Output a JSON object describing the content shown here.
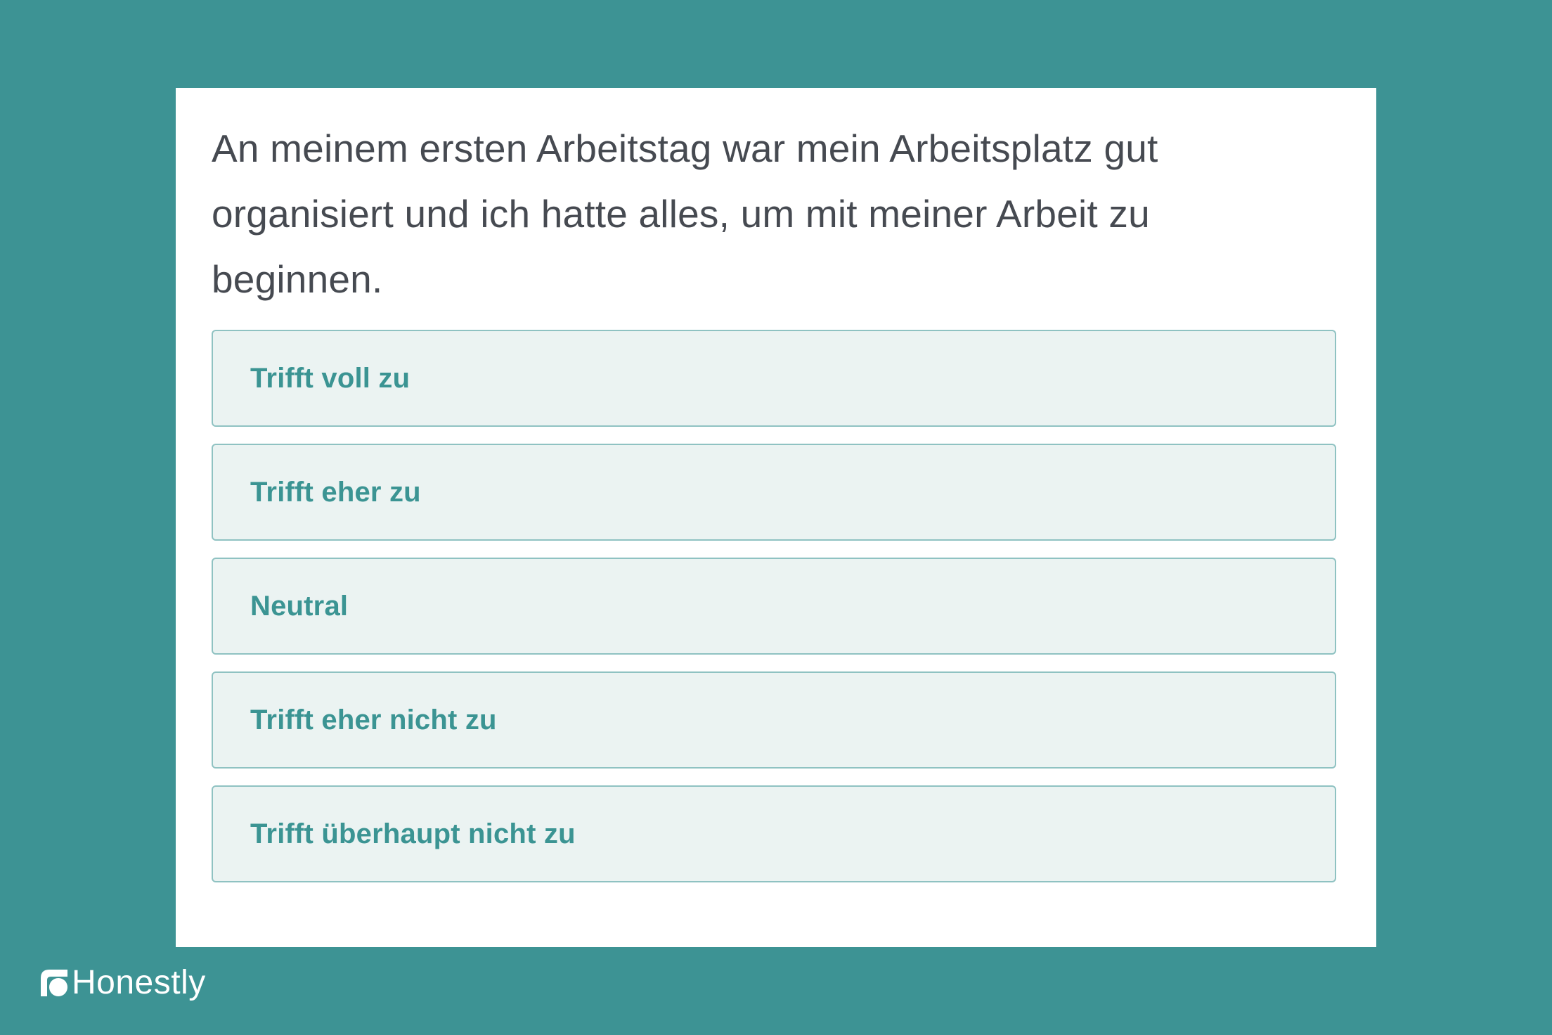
{
  "question": {
    "text": "An meinem ersten Arbeitstag war mein Arbeitsplatz gut organisiert und ich hatte alles, um mit meiner Arbeit zu beginnen."
  },
  "options": [
    {
      "label": "Trifft voll zu"
    },
    {
      "label": "Trifft eher zu"
    },
    {
      "label": "Neutral"
    },
    {
      "label": "Trifft eher nicht zu"
    },
    {
      "label": "Trifft überhaupt nicht zu"
    }
  ],
  "brand": {
    "name": "Honestly",
    "icon": "honestly-logo-icon"
  },
  "colors": {
    "background": "#3d9394",
    "card": "#ffffff",
    "question_text": "#464a51",
    "option_fill": "#ebf3f2",
    "option_border": "#8fc2c2",
    "option_text": "#3b9493"
  }
}
